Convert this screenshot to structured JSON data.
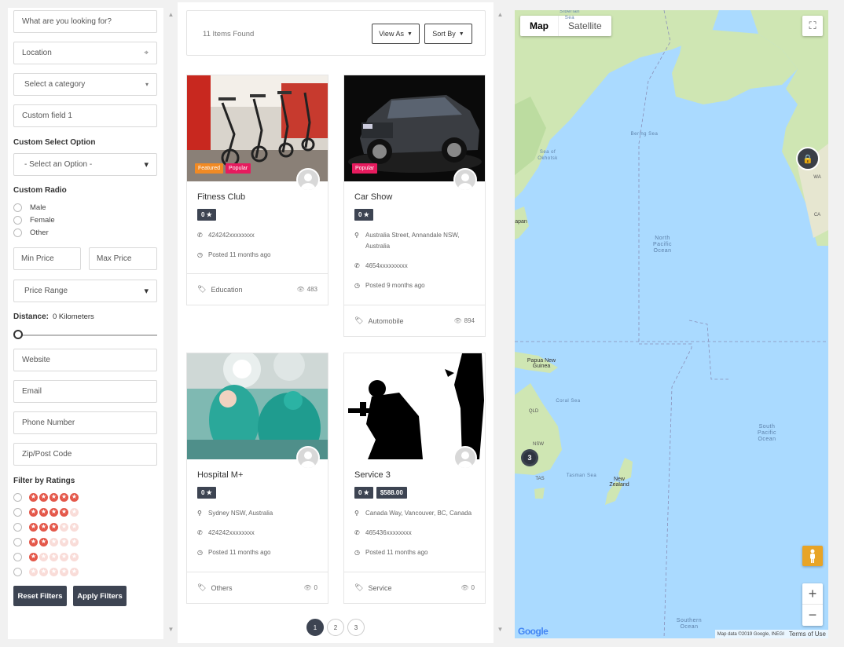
{
  "filters": {
    "search_placeholder": "What are you looking for?",
    "location_placeholder": "Location",
    "category_placeholder": "Select a category",
    "custom_field_1": "Custom field 1",
    "custom_select_label": "Custom Select Option",
    "custom_select_value": "- Select an Option -",
    "custom_radio_label": "Custom Radio",
    "radio_options": [
      "Male",
      "Female",
      "Other"
    ],
    "min_price": "Min Price",
    "max_price": "Max Price",
    "price_range": "Price Range",
    "distance_label": "Distance:",
    "distance_value": "0 Kilometers",
    "website": "Website",
    "email": "Email",
    "phone": "Phone Number",
    "zip": "Zip/Post Code",
    "ratings_label": "Filter by Ratings",
    "ratings": [
      5,
      4,
      3,
      2,
      1,
      0
    ],
    "reset": "Reset Filters",
    "apply": "Apply Filters"
  },
  "results": {
    "count": "11 Items Found",
    "view_as": "View As",
    "sort_by": "Sort By"
  },
  "listings": [
    {
      "title": "Fitness Club",
      "rating": "0 ★",
      "price": "",
      "badges": [
        "Featured",
        "Popular"
      ],
      "address": "",
      "phone": "424242xxxxxxxx",
      "posted": "Posted 11 months ago",
      "category": "Education",
      "views": "483"
    },
    {
      "title": "Car Show",
      "rating": "0 ★",
      "price": "",
      "badges": [
        "Popular"
      ],
      "address": "Australia Street, Annandale NSW, Australia",
      "phone": "4654xxxxxxxxx",
      "posted": "Posted 9 months ago",
      "category": "Automobile",
      "views": "894"
    },
    {
      "title": "Hospital M+",
      "rating": "0 ★",
      "price": "",
      "badges": [],
      "address": "Sydney NSW, Australia",
      "phone": "424242xxxxxxxx",
      "posted": "Posted 11 months ago",
      "category": "Others",
      "views": "0"
    },
    {
      "title": "Service 3",
      "rating": "0 ★",
      "price": "$588.00",
      "badges": [],
      "address": "Canada Way, Vancouver, BC, Canada",
      "phone": "465436xxxxxxxx",
      "posted": "Posted 11 months ago",
      "category": "Service",
      "views": "0"
    }
  ],
  "pagination": [
    "1",
    "2",
    "3"
  ],
  "map": {
    "map_tab": "Map",
    "satellite_tab": "Satellite",
    "cluster_count": "3",
    "labels": {
      "north_pacific": "North\nPacific\nOcean",
      "south_pacific": "South\nPacific\nOcean",
      "southern": "Southern\nOcean",
      "bering": "Bering Sea",
      "okhotsk": "Sea of\nOkhotsk",
      "coral": "Coral Sea",
      "tasman": "Tasman Sea",
      "siberian": "Siberian Sea",
      "png": "Papua New\nGuinea",
      "nz": "New\nZealand",
      "japan": "apan",
      "qld": "QLD",
      "nsw": "NSW",
      "tas": "TAS",
      "wa": "WA",
      "ca": "CA"
    },
    "attribution": "Map data ©2019 Google, INEGI",
    "terms": "Terms of Use",
    "google": "Google"
  },
  "colors": {
    "dark": "#3d4452",
    "featured": "#f18a24",
    "popular": "#e61b5e",
    "star": "#e4584a",
    "water": "#aadaff",
    "land": "#cfe6b3"
  }
}
